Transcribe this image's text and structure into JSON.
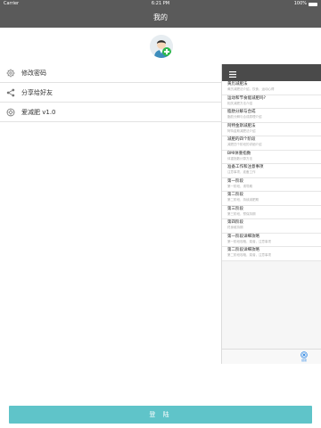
{
  "status_bar": {
    "carrier": "Carrier",
    "time": "6:21 PM",
    "battery": "100%"
  },
  "nav": {
    "title": "我的"
  },
  "menu": [
    {
      "label": "修改密码",
      "icon": "gear-icon"
    },
    {
      "label": "分享给好友",
      "icon": "share-icon"
    },
    {
      "label": "爱减肥 v1.0",
      "icon": "flower-icon"
    }
  ],
  "panel": {
    "items": [
      {
        "title": "黄历减肥法",
        "subtitle": "黄历减肥法介绍，饮食，运动心得"
      },
      {
        "title": "运动和节食能减肥吗?",
        "subtitle": "相关减肥方法介绍"
      },
      {
        "title": "脂肪分解与合成",
        "subtitle": "脂肪分解与合成原理介绍"
      },
      {
        "title": "阿特金斯减肥法",
        "subtitle": "阿特金斯减肥法介绍"
      },
      {
        "title": "减肥的四个阶段",
        "subtitle": "减肥四个阶段的详细介绍"
      },
      {
        "title": "BMI体重指数",
        "subtitle": "体重指数计算方法"
      },
      {
        "title": "准备工作和注意事项",
        "subtitle": "注意事项，准备工作"
      },
      {
        "title": "第一阶段",
        "subtitle": "第一阶段，诱导期"
      },
      {
        "title": "第二阶段",
        "subtitle": "第二阶段，持续减肥期"
      },
      {
        "title": "第三阶段",
        "subtitle": "第三阶段，预保持期"
      },
      {
        "title": "第四阶段",
        "subtitle": "终身维持期"
      },
      {
        "title": "第一阶段详细攻略",
        "subtitle": "第一阶段攻略，菜谱，注意事项"
      },
      {
        "title": "第二阶段详细攻略",
        "subtitle": "第二阶段攻略，菜谱，注意事项"
      }
    ],
    "tab_label": "健康"
  },
  "login": {
    "label": "登 陆"
  },
  "colors": {
    "nav": "#5a5a5a",
    "button": "#5fc4c9",
    "panel_head": "#4a4a4a",
    "tab_accent": "#3a8ee6"
  }
}
